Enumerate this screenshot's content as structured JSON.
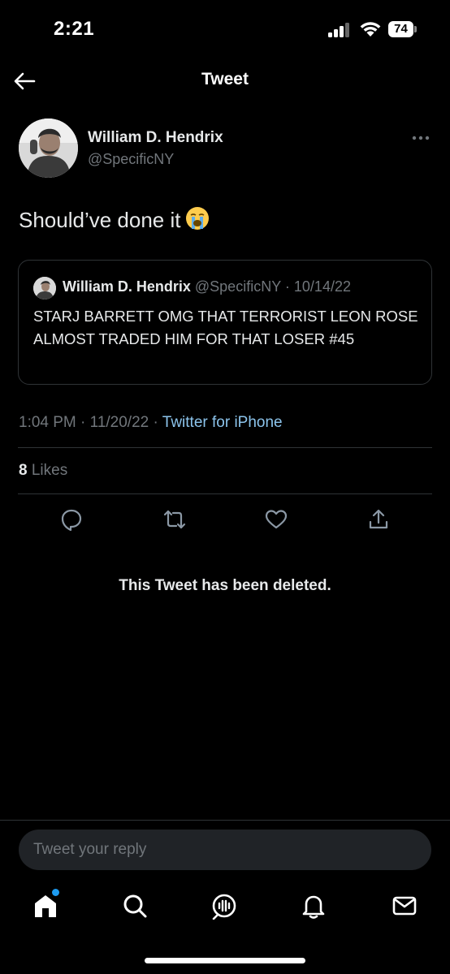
{
  "status_bar": {
    "time": "2:21",
    "battery": "74"
  },
  "header": {
    "title": "Tweet",
    "back_icon": "arrow-left-icon"
  },
  "tweet": {
    "author_name": "William D. Hendrix",
    "author_handle": "@SpecificNY",
    "text": "Should’ve done it",
    "emoji": "loudly-crying-face",
    "more_icon": "more-horizontal-icon",
    "quote": {
      "author_name": "William D. Hendrix",
      "author_handle": "@SpecificNY",
      "separator": "·",
      "date": "10/14/22",
      "text": "STARJ BARRETT OMG THAT TERRORIST LEON ROSE ALMOST TRADED HIM FOR THAT LOSER #45"
    },
    "time": "1:04 PM",
    "date": "11/20/22",
    "separator": "·",
    "source": "Twitter for iPhone",
    "likes_count": "8",
    "likes_label": "Likes",
    "actions": [
      "reply-icon",
      "retweet-icon",
      "like-icon",
      "share-icon"
    ]
  },
  "deleted_notice": "This Tweet has been deleted.",
  "reply": {
    "placeholder": "Tweet your reply"
  },
  "tab_bar": {
    "items": [
      "home-icon",
      "search-icon",
      "spaces-icon",
      "notifications-icon",
      "messages-icon"
    ],
    "home_badge_color": "#1d9bf0"
  },
  "colors": {
    "background": "#000000",
    "text": "#e7e9ea",
    "muted": "#71767b",
    "link": "#8cc4ec",
    "accent": "#1d9bf0"
  }
}
